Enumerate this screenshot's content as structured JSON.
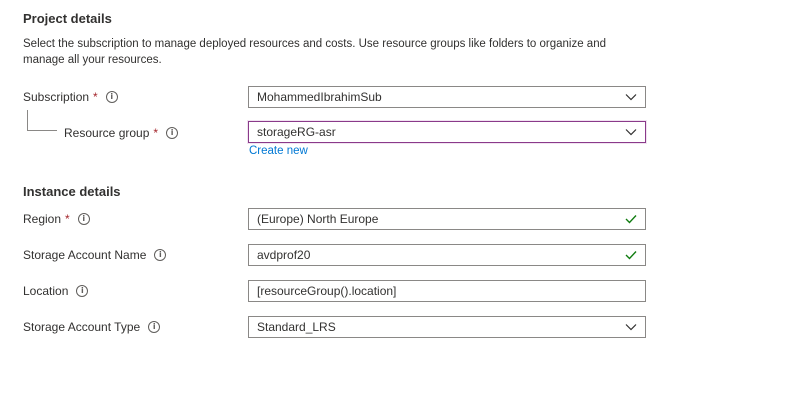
{
  "project": {
    "heading": "Project details",
    "description": "Select the subscription to manage deployed resources and costs. Use resource groups like folders to organize and manage all your resources.",
    "subscription": {
      "label": "Subscription",
      "required": "*",
      "value": "MohammedIbrahimSub"
    },
    "resource_group": {
      "label": "Resource group",
      "required": "*",
      "value": "storageRG-asr",
      "create_new": "Create new"
    }
  },
  "instance": {
    "heading": "Instance details",
    "region": {
      "label": "Region",
      "required": "*",
      "value": "(Europe) North Europe"
    },
    "storage_account_name": {
      "label": "Storage Account Name",
      "value": "avdprof20"
    },
    "location": {
      "label": "Location",
      "value": "[resourceGroup().location]"
    },
    "storage_account_type": {
      "label": "Storage Account Type",
      "value": "Standard_LRS"
    }
  },
  "info_glyph": "i",
  "colors": {
    "required": "#a4262c",
    "link": "#0078d4",
    "focus_border": "#8a3a8a",
    "border": "#8a8886"
  }
}
